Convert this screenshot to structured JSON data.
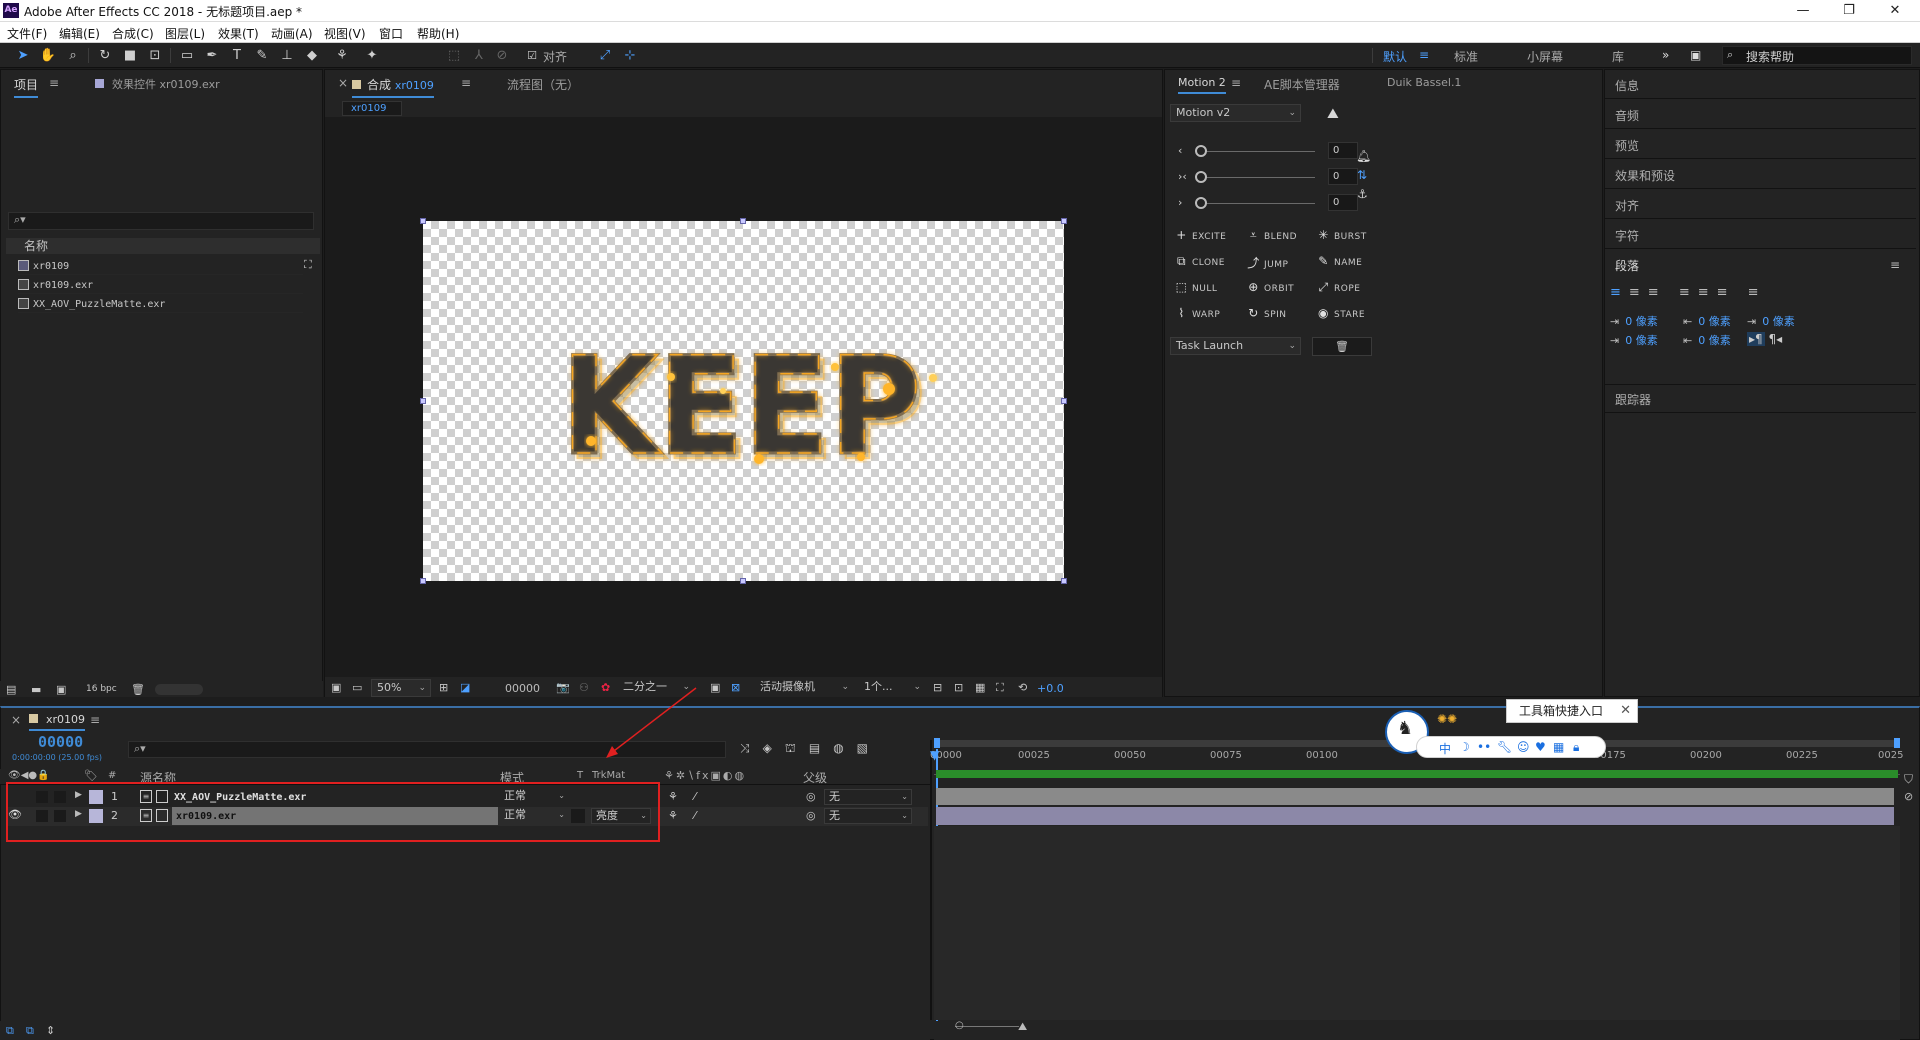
{
  "window": {
    "title": "Adobe After Effects CC 2018 - 无标题项目.aep *",
    "logo": "Ae"
  },
  "menu": [
    "文件(F)",
    "编辑(E)",
    "合成(C)",
    "图层(L)",
    "效果(T)",
    "动画(A)",
    "视图(V)",
    "窗口",
    "帮助(H)"
  ],
  "toolbar": {
    "snap_label": "对齐",
    "workspaces": [
      "默认",
      "标准",
      "小屏幕",
      "库"
    ],
    "active_workspace": "默认",
    "search_placeholder": "搜索帮助"
  },
  "project_panel": {
    "tab_project": "项目",
    "tab_effects": "效果控件 xr0109.exr",
    "column_name": "名称",
    "items": [
      "xr0109",
      "xr0109.exr",
      "XX_AOV_PuzzleMatte.exr"
    ],
    "bpc": "16 bpc"
  },
  "comp_panel": {
    "tab_prefix": "合成",
    "tab_name": "xr0109",
    "tab_flow": "流程图（无）",
    "sub_tab": "xr0109",
    "canvas_text": "KEEP",
    "zoom": "50%",
    "timecode": "00000",
    "resolution": "二分之一",
    "camera": "活动摄像机",
    "views": "1个...",
    "exposure": "+0.0"
  },
  "motion_panel": {
    "tabs": [
      "Motion 2",
      "AE脚本管理器",
      "Duik Bassel.1"
    ],
    "preset": "Motion v2",
    "sliders": [
      {
        "label": "‹",
        "value": "0"
      },
      {
        "label": "›‹",
        "value": "0"
      },
      {
        "label": "›",
        "value": "0"
      }
    ],
    "buttons": [
      {
        "label": "EXCITE",
        "icon": "+"
      },
      {
        "label": "BLEND",
        "icon": "⩡"
      },
      {
        "label": "BURST",
        "icon": "✳"
      },
      {
        "label": "CLONE",
        "icon": "⧉"
      },
      {
        "label": "JUMP",
        "icon": "⤴"
      },
      {
        "label": "NAME",
        "icon": "✎"
      },
      {
        "label": "NULL",
        "icon": "⬚"
      },
      {
        "label": "ORBIT",
        "icon": "⊕"
      },
      {
        "label": "ROPE",
        "icon": "⤢"
      },
      {
        "label": "WARP",
        "icon": "⌇"
      },
      {
        "label": "SPIN",
        "icon": "↻"
      },
      {
        "label": "STARE",
        "icon": "◉"
      }
    ],
    "task": "Task Launch"
  },
  "right_panel": {
    "items": [
      "信息",
      "音频",
      "预览",
      "效果和预设",
      "对齐",
      "字符"
    ],
    "paragraph_title": "段落",
    "indent_values": [
      "0 像素",
      "0 像素",
      "0 像素",
      "0 像素",
      "0 像素"
    ],
    "tracker": "跟踪器"
  },
  "timeline": {
    "tab": "xr0109",
    "timecode": "00000",
    "timecode_sub": "0:00:00:00 (25.00 fps)",
    "col_source": "源名称",
    "col_mode": "模式",
    "col_t": "T",
    "col_trkmat": "TrkMat",
    "col_parent": "父级",
    "layers": [
      {
        "num": "1",
        "name": "XX_AOV_PuzzleMatte.exr",
        "mode": "正常",
        "trkmat": "",
        "parent": "无"
      },
      {
        "num": "2",
        "name": "xr0109.exr",
        "mode": "正常",
        "trkmat": "亮度",
        "parent": "无"
      }
    ],
    "ruler": [
      "00000",
      "00025",
      "00050",
      "00075",
      "00100",
      "00175",
      "00200",
      "00225",
      "0025"
    ],
    "tooltip": "工具箱快捷入口",
    "widget_label": "中"
  },
  "colors": {
    "accent": "#3f8bd6",
    "selection": "#e02020",
    "layer_bar": "#8a8a8a",
    "layer_bar2": "#8c88a8",
    "work_area": "#2a8d2a"
  }
}
